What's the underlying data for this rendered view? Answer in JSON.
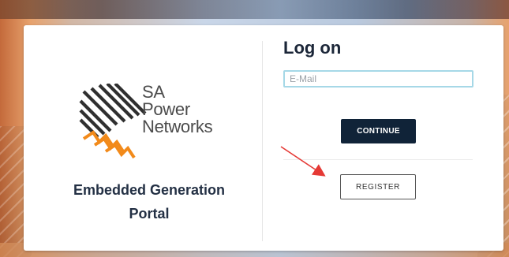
{
  "brand": {
    "logo_lines": [
      "SA",
      "Power",
      "Networks"
    ],
    "colors": {
      "card_bg": "#ffffff",
      "logo_dark": "#2f2f2f",
      "logo_orange": "#f28a1a",
      "title_dark": "#1b2638",
      "primary_button": "#102338",
      "input_focus": "#a6d8e7",
      "annotation": "#e53935"
    }
  },
  "portal": {
    "title": "Embedded Generation Portal"
  },
  "login": {
    "title": "Log on",
    "email_placeholder": "E-Mail",
    "email_value": "",
    "continue_label": "CONTINUE",
    "register_label": "REGISTER"
  },
  "icons": {
    "logo": "sa-power-networks-logo",
    "annotation": "red-arrow"
  }
}
